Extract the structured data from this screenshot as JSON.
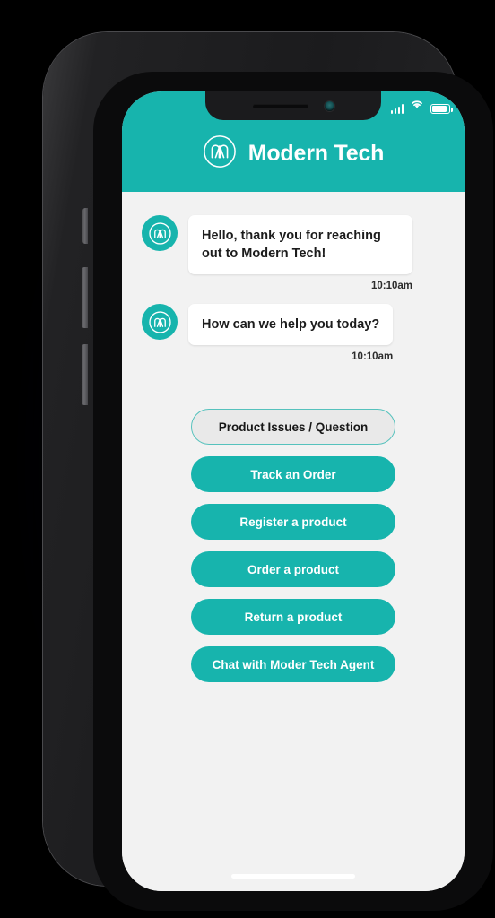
{
  "device": {
    "notch": {
      "speaker": "earpiece-speaker",
      "camera": "front-camera"
    },
    "side_buttons": [
      "silent-switch",
      "volume-up",
      "volume-down",
      "power"
    ]
  },
  "status_bar": {
    "signal_icon": "cellular-signal-icon",
    "wifi_icon": "wifi-icon",
    "battery_icon": "battery-icon"
  },
  "header": {
    "logo_icon": "modern-tech-logo-icon",
    "title": "Modern Tech",
    "background_color": "#17b4ad"
  },
  "chat": {
    "avatar_icon": "modern-tech-avatar-icon",
    "messages": [
      {
        "text": "Hello, thank you for reaching out to Modern Tech!",
        "time": "10:10am",
        "sender": "bot"
      },
      {
        "text": "How can we help you today?",
        "time": "10:10am",
        "sender": "bot"
      }
    ]
  },
  "quick_replies": [
    {
      "label": "Product Issues / Question",
      "style": "outlined"
    },
    {
      "label": "Track an Order",
      "style": "filled"
    },
    {
      "label": "Register a product",
      "style": "filled"
    },
    {
      "label": "Order a product",
      "style": "filled"
    },
    {
      "label": "Return a product",
      "style": "filled"
    },
    {
      "label": "Chat with Moder Tech Agent",
      "style": "filled"
    }
  ],
  "colors": {
    "accent": "#17b4ad",
    "accent_border": "#56c2bd",
    "screen_background": "#f2f2f2",
    "bubble_background": "#ffffff",
    "text_dark": "#1c1c1c",
    "outlined_fill": "#e9e9e9"
  },
  "home_indicator": "home-indicator"
}
